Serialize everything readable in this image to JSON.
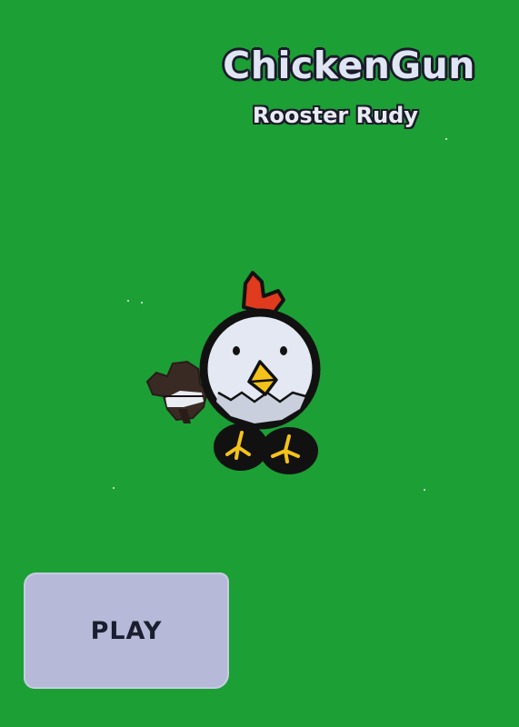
{
  "game": {
    "title": "ChickenGun",
    "character_name": "Rooster Rudy",
    "play_label": "PLAY"
  },
  "colors": {
    "background": "#1c9f35",
    "title_fill": "#dfe5f2",
    "outline": "#1a1a2a",
    "button_fill": "#b6bad8",
    "comb": "#e03a1f",
    "beak": "#f4c21a",
    "chicken_body": "#e4e8f2"
  },
  "icons": {
    "character": "chicken-icon",
    "weapon": "gun-icon"
  }
}
